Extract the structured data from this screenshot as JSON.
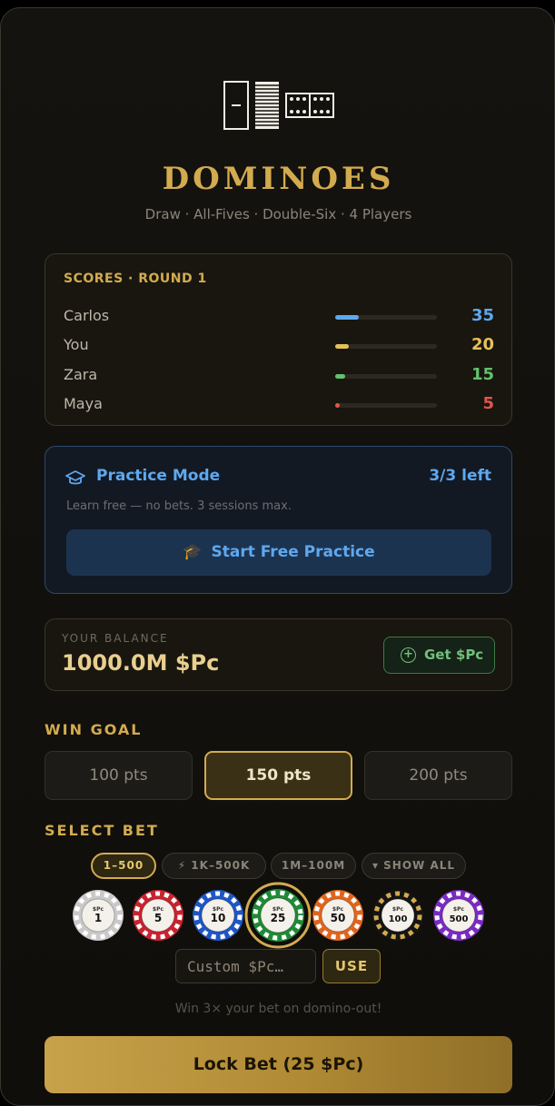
{
  "header": {
    "title": "DOMINOES",
    "subtitle": "Draw · All-Fives · Double-Six · 4 Players"
  },
  "scores": {
    "heading": "SCORES · ROUND 1",
    "rows": [
      {
        "name": "Carlos",
        "score": "35",
        "color": "#5ea8ef",
        "fill": 0.23
      },
      {
        "name": "You",
        "score": "20",
        "color": "#e6c05a",
        "fill": 0.13
      },
      {
        "name": "Zara",
        "score": "15",
        "color": "#63c06d",
        "fill": 0.1
      },
      {
        "name": "Maya",
        "score": "5",
        "color": "#e0564a",
        "fill": 0.03
      }
    ]
  },
  "practice": {
    "title": "Practice Mode",
    "remaining": "3/3 left",
    "description": "Learn free — no bets. 3 sessions max.",
    "button_label": "Start Free Practice",
    "button_icon": "🎓"
  },
  "balance": {
    "label": "YOUR BALANCE",
    "value": "1000.0M $Pc",
    "get_label": "Get $Pc"
  },
  "win_goal": {
    "label": "WIN GOAL",
    "options": [
      "100 pts",
      "150 pts",
      "200 pts"
    ],
    "selected": "150 pts"
  },
  "bet": {
    "label": "SELECT BET",
    "ranges": [
      {
        "label": "1–500",
        "active": true
      },
      {
        "label": "⚡ 1K–500K",
        "active": false
      },
      {
        "label": "1M–100M",
        "active": false
      },
      {
        "label": "▾ SHOW ALL",
        "active": false
      }
    ],
    "chips": [
      {
        "value": "1",
        "color": "#c9c9c9"
      },
      {
        "value": "5",
        "color": "#c8232f"
      },
      {
        "value": "10",
        "color": "#1f56c4"
      },
      {
        "value": "25",
        "color": "#1f8a36"
      },
      {
        "value": "50",
        "color": "#e0651c"
      },
      {
        "value": "100",
        "color": "#141414"
      },
      {
        "value": "500",
        "color": "#7a2bc2"
      }
    ],
    "chip_unit": "$Pc",
    "selected_chip": "25",
    "custom_placeholder": "Custom $Pc…",
    "use_label": "USE",
    "win_note": "Win 3× your bet on domino-out!",
    "lock_label": "Lock Bet (25 $Pc)"
  },
  "colors": {
    "accent": "#d3ab4f",
    "practice_blue": "#5ea8ef",
    "success_green": "#72c07a"
  }
}
